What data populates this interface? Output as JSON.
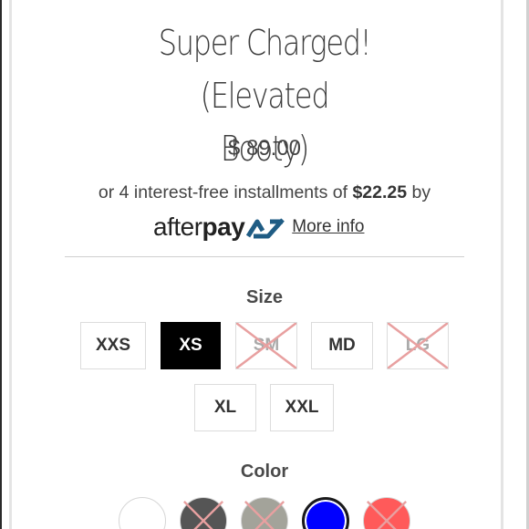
{
  "product": {
    "title_line1": "Super Charged! (Elevated",
    "title_line2": "Booty)",
    "price": "$ 89.00"
  },
  "installments": {
    "prefix": "or 4 interest-free installments of ",
    "amount": "$22.25",
    "suffix": " by",
    "logo_light": "after",
    "logo_bold": "pay",
    "more_info": "More info"
  },
  "size": {
    "label": "Size",
    "options": [
      {
        "label": "XXS",
        "state": "available"
      },
      {
        "label": "XS",
        "state": "selected"
      },
      {
        "label": "SM",
        "state": "unavailable"
      },
      {
        "label": "MD",
        "state": "available"
      },
      {
        "label": "LG",
        "state": "unavailable"
      },
      {
        "label": "XL",
        "state": "available"
      },
      {
        "label": "XXL",
        "state": "available"
      }
    ]
  },
  "color": {
    "label": "Color",
    "swatches": [
      {
        "color": "#ffffff",
        "state": "available"
      },
      {
        "color": "#555555",
        "state": "unavailable"
      },
      {
        "color": "#a3a39a",
        "state": "unavailable"
      },
      {
        "color": "#0000ff",
        "state": "selected"
      },
      {
        "color": "#ff5a5a",
        "state": "unavailable"
      }
    ]
  },
  "colors": {
    "unavailable_cross": "#e8a0a0",
    "afterpay_mark": "#1f5c84"
  },
  "icons": {
    "afterpay": "afterpay-logo-icon",
    "unavailable": "cross-icon"
  }
}
